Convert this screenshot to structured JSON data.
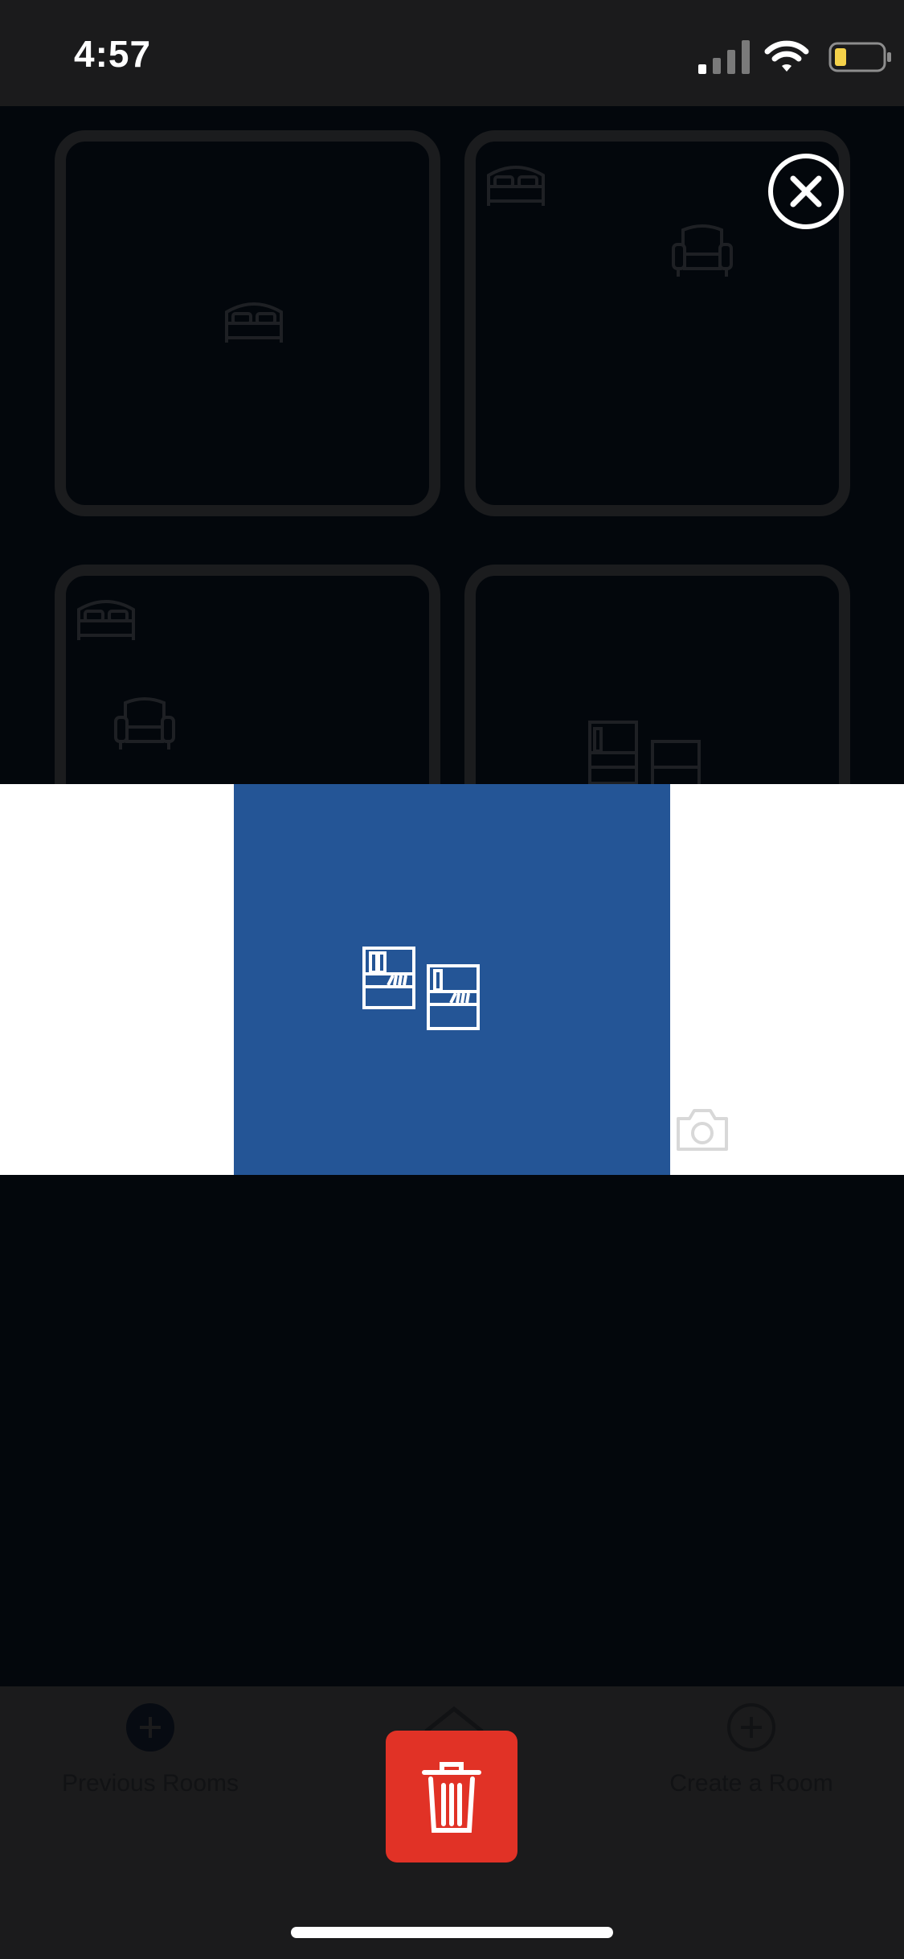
{
  "status_bar": {
    "time": "4:57",
    "icons": [
      "cellular-signal-icon",
      "wifi-icon",
      "battery-low-icon"
    ]
  },
  "room_grid": {
    "tiles": [
      {
        "name": "room-tile-1",
        "icons": [
          "bed-icon"
        ]
      },
      {
        "name": "room-tile-2",
        "icons": [
          "bed-icon",
          "armchair-icon"
        ]
      },
      {
        "name": "room-tile-3",
        "icons": [
          "bed-icon",
          "armchair-icon"
        ]
      },
      {
        "name": "room-tile-4",
        "icons": [
          "bookshelf-icon",
          "bookshelf-icon"
        ]
      }
    ],
    "close_icon": "close-circle-icon"
  },
  "preview_modal": {
    "background_color": "#245596",
    "icon": "bookshelves-icon",
    "camera_icon": "camera-icon"
  },
  "tab_bar": {
    "previous_rooms_label": "Previous Rooms",
    "create_room_label": "Create a Room",
    "delete_icon": "trash-icon",
    "delete_color": "#e13226"
  }
}
